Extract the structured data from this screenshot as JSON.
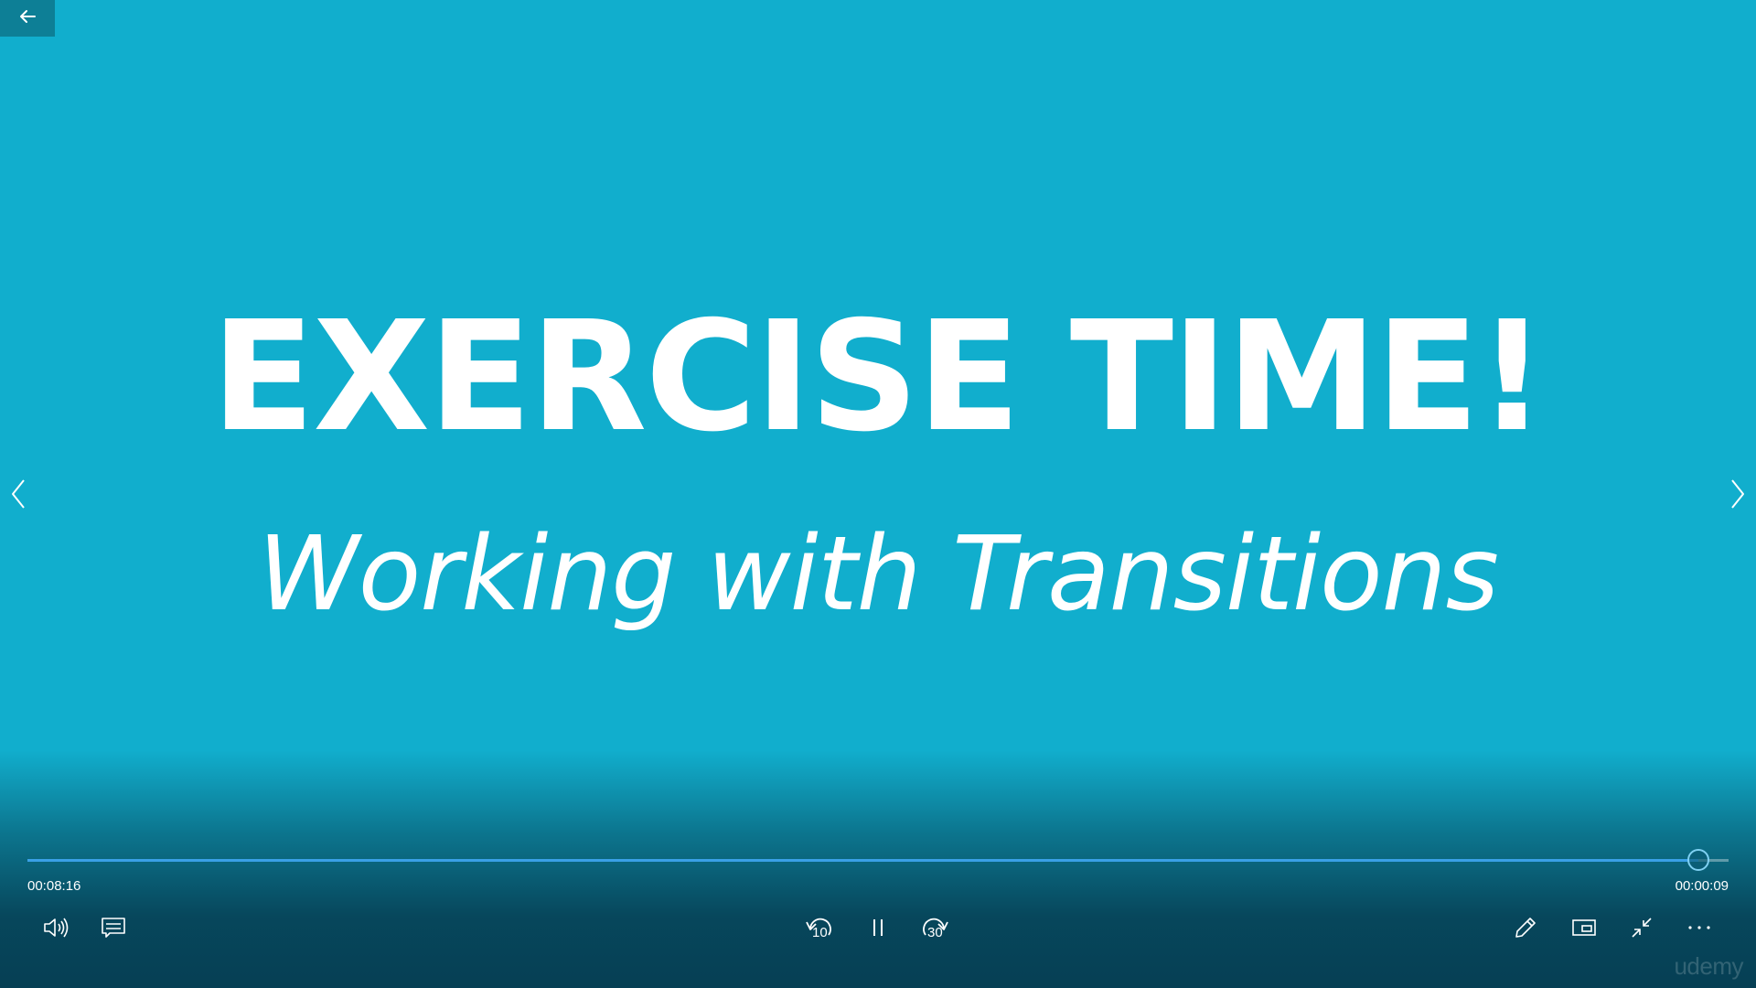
{
  "slide": {
    "title": "EXERCISE TIME!",
    "subtitle": "Working with Transitions"
  },
  "player": {
    "elapsed": "00:08:16",
    "remaining": "00:00:09",
    "progress_fraction": 0.982,
    "skip_back_seconds": "10",
    "skip_forward_seconds": "30",
    "watermark": "udemy"
  },
  "colors": {
    "background": "#11aecd",
    "seek_fill": "#3aa0e6",
    "text": "#ffffff"
  },
  "icons": {
    "back": "arrow-left-icon",
    "prev": "chevron-left-icon",
    "next": "chevron-right-icon",
    "volume": "speaker-icon",
    "captions": "captions-icon",
    "skip_back": "rewind-10-icon",
    "pause": "pause-icon",
    "skip_forward": "forward-30-icon",
    "edit": "pencil-icon",
    "mini_view": "mini-view-icon",
    "exit_fullscreen": "exit-fullscreen-icon",
    "more": "more-icon"
  }
}
